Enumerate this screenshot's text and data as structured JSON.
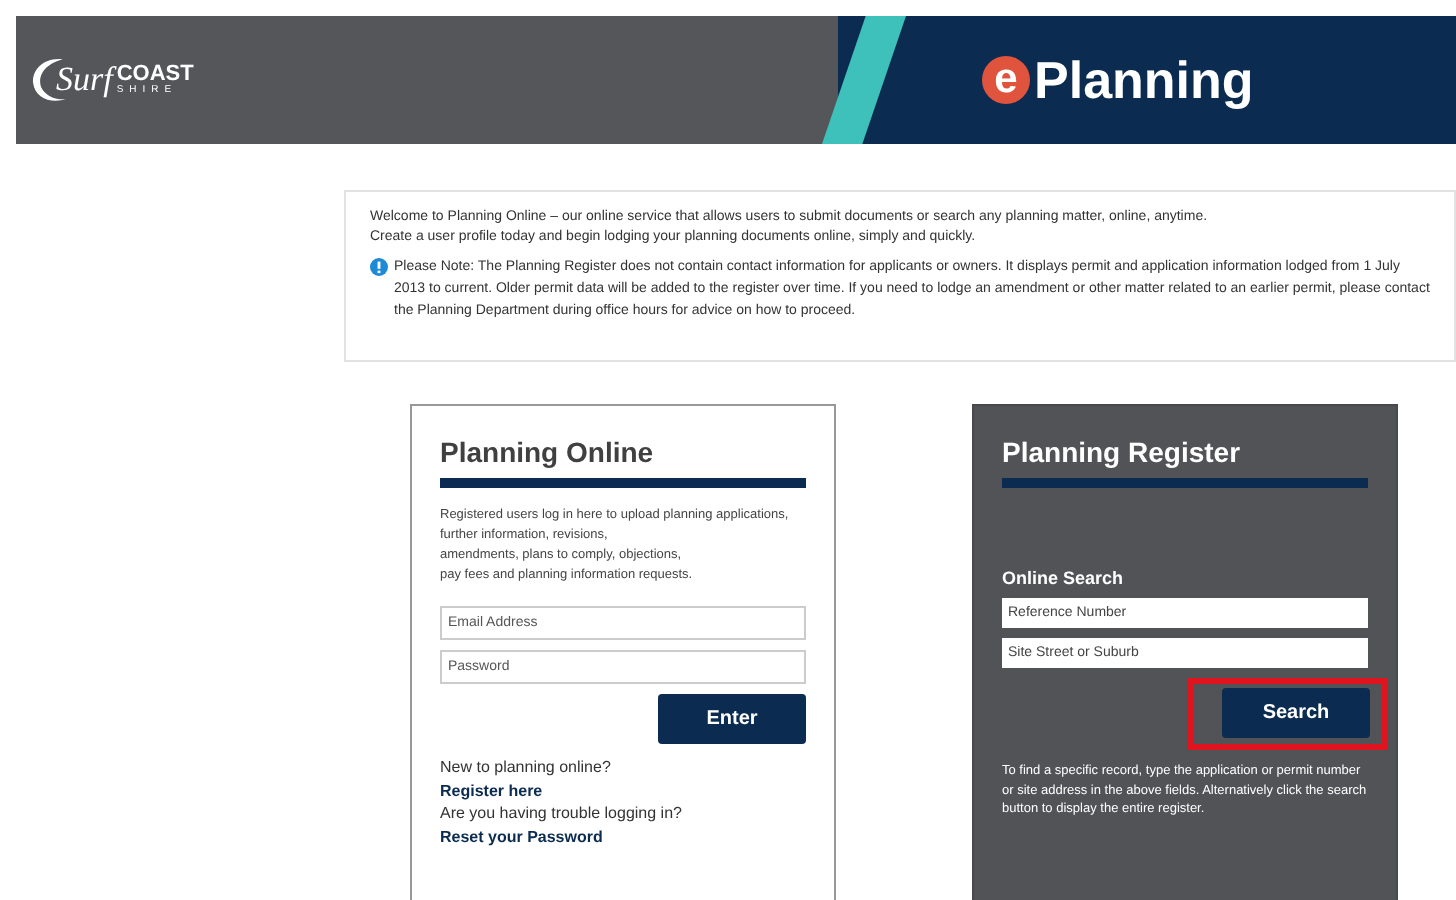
{
  "header": {
    "logo": {
      "script": "Surf",
      "word": "COAST",
      "sub": "SHIRE"
    },
    "brand": {
      "mark": "e",
      "name": "Planning"
    }
  },
  "notice": {
    "lines": [
      "Welcome to Planning Online – our online service that allows users to submit documents or search any planning matter, online, anytime.",
      "Create a user profile today and begin lodging your planning documents online, simply and quickly."
    ],
    "note": "Please Note: The Planning Register does not contain contact information for applicants or owners. It displays permit and application information lodged from 1 July 2013 to current. Older permit data will be added to the register over time. If you need to lodge an amendment or other matter related to an earlier permit, please contact the Planning Department during office hours for advice on how to proceed."
  },
  "login": {
    "title": "Planning Online",
    "intro_lines": [
      "Registered users log in here to upload planning applications,",
      "further information, revisions,",
      "amendments, plans to comply, objections,",
      "pay fees and planning information requests."
    ],
    "fields": [
      {
        "placeholder": "Email Address"
      },
      {
        "placeholder": "Password"
      }
    ],
    "button": "Enter",
    "links": [
      {
        "kind": "text",
        "text": "New to planning online?"
      },
      {
        "kind": "link",
        "text": "Register here"
      },
      {
        "kind": "text",
        "text": "Are you having trouble logging in?"
      },
      {
        "kind": "link",
        "text": "Reset your Password"
      }
    ]
  },
  "register": {
    "title": "Planning Register",
    "subtitle": "Online Search",
    "fields": [
      {
        "placeholder": "Reference Number"
      },
      {
        "placeholder": "Site Street or Suburb"
      }
    ],
    "button": "Search",
    "button_highlighted": true,
    "help": "To find a specific record, type the application or permit number or site address in the above fields. Alternatively click the search button to display the entire register."
  }
}
